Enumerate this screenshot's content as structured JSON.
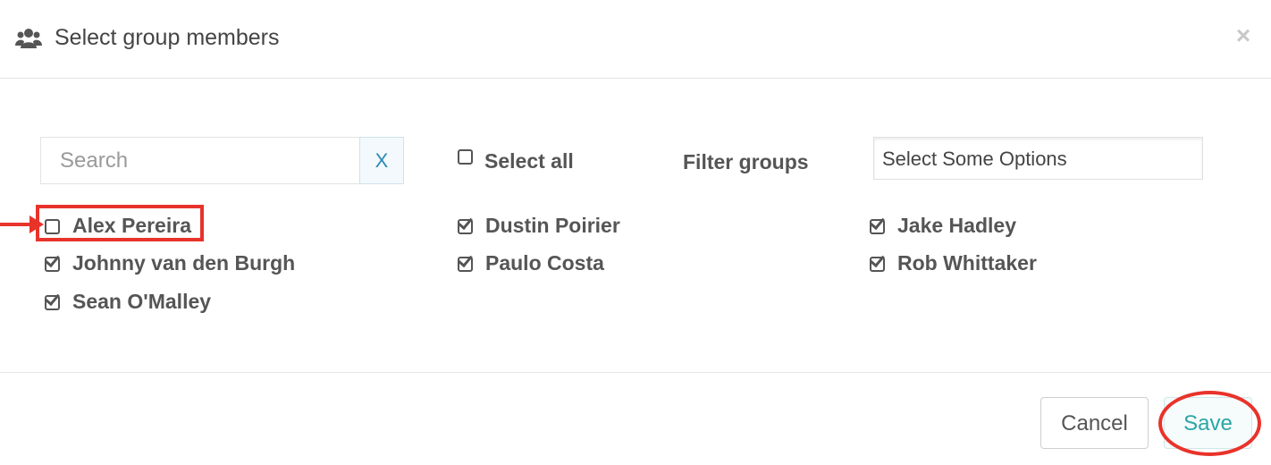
{
  "header": {
    "title": "Select group members",
    "icon": "users-icon",
    "close_label": "×"
  },
  "search": {
    "placeholder": "Search",
    "value": "",
    "clear_label": "X"
  },
  "select_all": {
    "label": "Select all",
    "checked": false
  },
  "filter": {
    "label": "Filter groups",
    "placeholder": "Select Some Options"
  },
  "members": [
    {
      "name": "Alex Pereira",
      "checked": false
    },
    {
      "name": "Dustin Poirier",
      "checked": true
    },
    {
      "name": "Jake Hadley",
      "checked": true
    },
    {
      "name": "Johnny van den Burgh",
      "checked": true
    },
    {
      "name": "Paulo Costa",
      "checked": true
    },
    {
      "name": "Rob Whittaker",
      "checked": true
    },
    {
      "name": "Sean O'Malley",
      "checked": true
    }
  ],
  "footer": {
    "cancel_label": "Cancel",
    "save_label": "Save"
  },
  "colors": {
    "annotation_red": "#e8332b",
    "save_teal": "#2aa6a6",
    "clear_blue": "#2a8ab8"
  }
}
